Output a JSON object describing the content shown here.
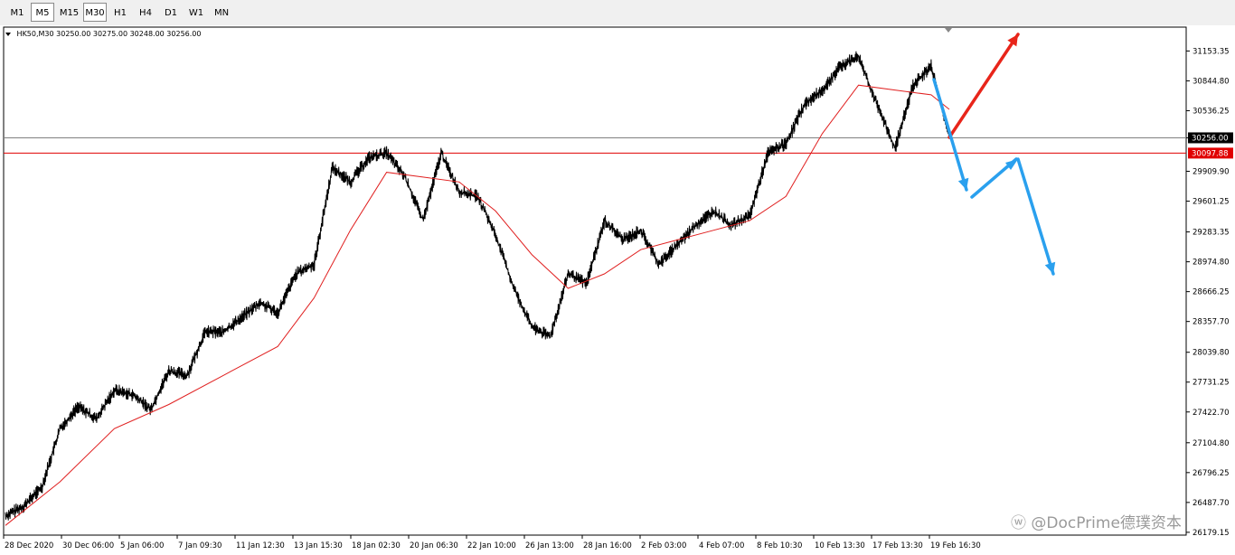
{
  "toolbar": {
    "timeframes": [
      {
        "label": "M1",
        "active": false
      },
      {
        "label": "M5",
        "active": true
      },
      {
        "label": "M15",
        "active": false
      },
      {
        "label": "M30",
        "active": true
      },
      {
        "label": "H1",
        "active": false
      },
      {
        "label": "H4",
        "active": false
      },
      {
        "label": "D1",
        "active": false
      },
      {
        "label": "W1",
        "active": false
      },
      {
        "label": "MN",
        "active": false
      }
    ]
  },
  "chart": {
    "header": "HK50,M30  30250.00 30275.00 30248.00 30256.00",
    "current_price_label": "30256.00",
    "level_label": "30097.88",
    "watermark": "ⓦ @DocPrime德璞资本",
    "colors": {
      "price": "#000000",
      "moving_average": "#e02020",
      "level_line": "#e00000",
      "current_price_line": "#808080",
      "arrow_up": "#e8251a",
      "arrow_down": "#2aa0ee",
      "level_tag_bg": "#e00000",
      "current_tag_bg": "#000000"
    }
  },
  "chart_data": {
    "type": "line",
    "symbol": "HK50",
    "timeframe": "M30",
    "ohlc_last": {
      "open": 30250.0,
      "high": 30275.0,
      "low": 30248.0,
      "close": 30256.0
    },
    "x_tick_labels": [
      "28 Dec 2020",
      "30 Dec 06:00",
      "5 Jan 06:00",
      "7 Jan 09:30",
      "11 Jan 12:30",
      "13 Jan 15:30",
      "18 Jan 02:30",
      "20 Jan 06:30",
      "22 Jan 10:00",
      "26 Jan 13:00",
      "28 Jan 16:00",
      "2 Feb 03:00",
      "4 Feb 07:00",
      "8 Feb 10:30",
      "10 Feb 13:30",
      "17 Feb 13:30",
      "19 Feb 16:30"
    ],
    "y_tick_labels": [
      "31153.35",
      "30844.80",
      "30536.25",
      "30256.00",
      "29909.90",
      "29601.25",
      "29283.35",
      "28974.80",
      "28666.25",
      "28357.70",
      "28039.80",
      "27731.25",
      "27422.70",
      "27104.80",
      "26796.25",
      "26487.70",
      "26179.15"
    ],
    "ylim": [
      26150,
      31400
    ],
    "current_price": 30256.0,
    "horizontal_level": 30097.88,
    "series": [
      {
        "name": "HK50",
        "points": [
          [
            0,
            26350
          ],
          [
            1,
            26450
          ],
          [
            2,
            26650
          ],
          [
            3,
            27250
          ],
          [
            4,
            27480
          ],
          [
            5,
            27350
          ],
          [
            6,
            27650
          ],
          [
            7,
            27600
          ],
          [
            8,
            27450
          ],
          [
            9,
            27850
          ],
          [
            10,
            27800
          ],
          [
            11,
            28250
          ],
          [
            12,
            28250
          ],
          [
            13,
            28400
          ],
          [
            14,
            28550
          ],
          [
            15,
            28450
          ],
          [
            16,
            28850
          ],
          [
            17,
            28950
          ],
          [
            18,
            29950
          ],
          [
            19,
            29800
          ],
          [
            20,
            30050
          ],
          [
            21,
            30100
          ],
          [
            22,
            29850
          ],
          [
            23,
            29400
          ],
          [
            24,
            30100
          ],
          [
            25,
            29700
          ],
          [
            26,
            29650
          ],
          [
            27,
            29250
          ],
          [
            28,
            28700
          ],
          [
            29,
            28300
          ],
          [
            30,
            28200
          ],
          [
            31,
            28850
          ],
          [
            32,
            28750
          ],
          [
            33,
            29400
          ],
          [
            34,
            29200
          ],
          [
            35,
            29300
          ],
          [
            36,
            28950
          ],
          [
            37,
            29150
          ],
          [
            38,
            29350
          ],
          [
            39,
            29500
          ],
          [
            40,
            29350
          ],
          [
            41,
            29450
          ],
          [
            42,
            30100
          ],
          [
            43,
            30200
          ],
          [
            44,
            30600
          ],
          [
            45,
            30750
          ],
          [
            46,
            31000
          ],
          [
            47,
            31100
          ],
          [
            48,
            30600
          ],
          [
            49,
            30150
          ],
          [
            50,
            30800
          ],
          [
            51,
            31000
          ],
          [
            52,
            30250
          ]
        ]
      },
      {
        "name": "MA",
        "points": [
          [
            0,
            26250
          ],
          [
            3,
            26700
          ],
          [
            6,
            27250
          ],
          [
            9,
            27500
          ],
          [
            12,
            27800
          ],
          [
            15,
            28100
          ],
          [
            17,
            28600
          ],
          [
            19,
            29300
          ],
          [
            21,
            29900
          ],
          [
            23,
            29850
          ],
          [
            25,
            29800
          ],
          [
            27,
            29500
          ],
          [
            29,
            29050
          ],
          [
            31,
            28700
          ],
          [
            33,
            28850
          ],
          [
            35,
            29100
          ],
          [
            37,
            29200
          ],
          [
            39,
            29300
          ],
          [
            41,
            29400
          ],
          [
            43,
            29650
          ],
          [
            45,
            30300
          ],
          [
            47,
            30800
          ],
          [
            49,
            30750
          ],
          [
            51,
            30700
          ],
          [
            52,
            30550
          ]
        ]
      }
    ],
    "annotations": [
      {
        "type": "arrow",
        "color": "red",
        "direction": "up"
      },
      {
        "type": "arrow",
        "color": "blue",
        "direction": "down-up-down"
      }
    ]
  }
}
